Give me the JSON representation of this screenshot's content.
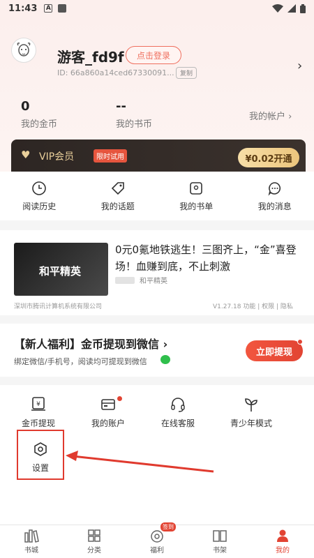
{
  "status_bar": {
    "time": "11:43",
    "notif_letter": "A"
  },
  "profile": {
    "username": "游客_fd9f",
    "login_label": "点击登录",
    "user_id": "ID: 66a860a14ced67330091...",
    "copy_label": "复制"
  },
  "stats": {
    "coins_value": "0",
    "coins_label": "我的金币",
    "book_coins_value": "--",
    "book_coins_label": "我的书币",
    "account_link": "我的帐户 ›"
  },
  "vip": {
    "label": "VIP会员",
    "badge": "限时试用",
    "button": "¥0.02开通"
  },
  "quick_actions": [
    {
      "label": "阅读历史",
      "icon": "clock-icon"
    },
    {
      "label": "我的话题",
      "icon": "tag-icon"
    },
    {
      "label": "我的书单",
      "icon": "booklist-icon"
    },
    {
      "label": "我的消息",
      "icon": "message-icon"
    }
  ],
  "ad": {
    "image_title": "和平精英",
    "close": "×",
    "title": "0元0氪地铁逃生！三图齐上，“金”喜登场！血赚到底，不止刺激",
    "source": "和平精英",
    "company": "深圳市腾讯计算机系统有限公司",
    "version": "V1.27.18  功能 | 权限 | 隐私"
  },
  "welfare": {
    "title": "【新人福利】金币提现到微信 ›",
    "subtitle": "绑定微信/手机号，阅读均可提现到微信",
    "button": "立即提现"
  },
  "services": [
    {
      "label": "金币提现",
      "icon": "withdraw-icon"
    },
    {
      "label": "我的账户",
      "icon": "wallet-icon"
    },
    {
      "label": "在线客服",
      "icon": "headset-icon"
    },
    {
      "label": "青少年模式",
      "icon": "sprout-icon"
    },
    {
      "label": "设置",
      "icon": "settings-icon"
    }
  ],
  "tabbar": [
    {
      "label": "书城",
      "icon": "bookstore-icon"
    },
    {
      "label": "分类",
      "icon": "category-icon"
    },
    {
      "label": "福利",
      "icon": "welfare-icon",
      "badge": "签到"
    },
    {
      "label": "书架",
      "icon": "bookshelf-icon"
    },
    {
      "label": "我的",
      "icon": "profile-icon",
      "active": true
    }
  ],
  "colors": {
    "accent": "#e24433",
    "vip_gold": "#e9cf9a",
    "annotation": "#e03a2e"
  }
}
